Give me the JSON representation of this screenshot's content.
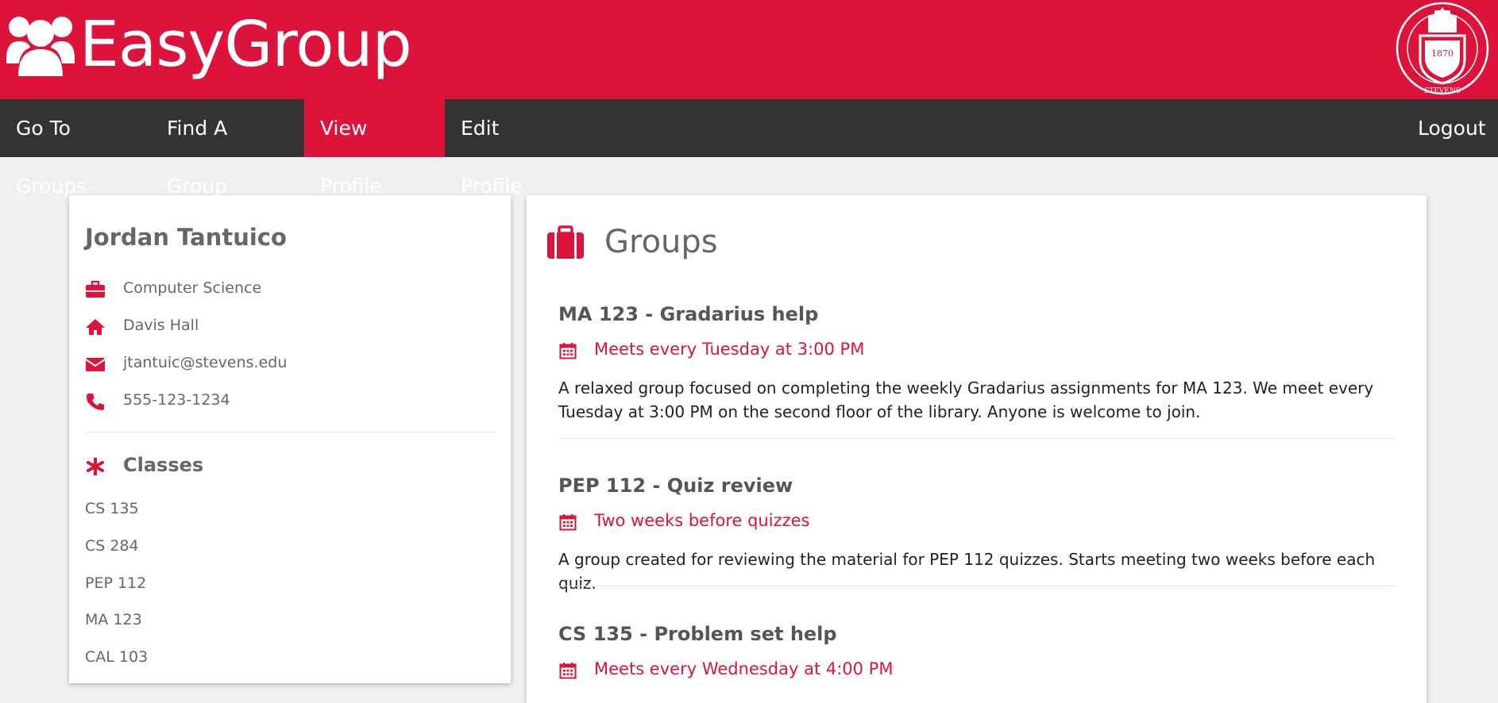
{
  "header": {
    "brand": "EasyGroup",
    "seal_year": "1870",
    "seal_name": "STEVENS",
    "colors": {
      "accent": "#dc143c",
      "nav_bg": "#333333"
    }
  },
  "nav": {
    "items": [
      {
        "label": "Go To Groups"
      },
      {
        "label": "Find A Group"
      },
      {
        "label": "View Profile",
        "active": true
      },
      {
        "label": "Edit Profile"
      }
    ],
    "logout": "Logout"
  },
  "profile": {
    "name": "Jordan Tantuico",
    "major": "Computer Science",
    "residence": "Davis Hall",
    "email": "jtantuic@stevens.edu",
    "phone": "555-123-1234",
    "classes_title": "Classes",
    "classes": [
      "CS 135",
      "CS 284",
      "PEP 112",
      "MA 123",
      "CAL 103"
    ],
    "icons": [
      "briefcase-icon",
      "home-icon",
      "envelope-icon",
      "phone-icon",
      "asterisk-icon"
    ]
  },
  "groups": {
    "title": "Groups",
    "items": [
      {
        "title": "MA 123 - Gradarius help",
        "meets": "Meets every Tuesday at 3:00 PM",
        "description": "A relaxed group focused on completing the weekly Gradarius assignments for MA 123. We meet every Tuesday at 3:00 PM on the second floor of the library. Anyone is welcome to join."
      },
      {
        "title": "PEP 112 - Quiz review",
        "meets": "Two weeks before quizzes",
        "description": "A group created for reviewing the material for PEP 112 quizzes. Starts meeting two weeks before each quiz."
      },
      {
        "title": "CS 135 - Problem set help",
        "meets": "Meets every Wednesday at 4:00 PM",
        "description": ""
      }
    ]
  }
}
